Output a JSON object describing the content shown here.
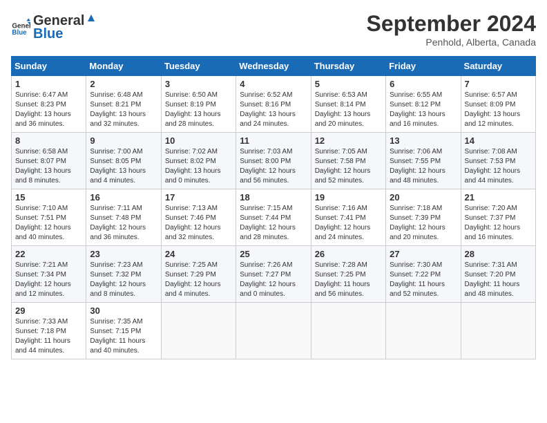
{
  "header": {
    "logo": {
      "general": "General",
      "blue": "Blue"
    },
    "title": "September 2024",
    "location": "Penhold, Alberta, Canada"
  },
  "calendar": {
    "headers": [
      "Sunday",
      "Monday",
      "Tuesday",
      "Wednesday",
      "Thursday",
      "Friday",
      "Saturday"
    ],
    "weeks": [
      [
        {
          "day": "1",
          "info": "Sunrise: 6:47 AM\nSunset: 8:23 PM\nDaylight: 13 hours\nand 36 minutes."
        },
        {
          "day": "2",
          "info": "Sunrise: 6:48 AM\nSunset: 8:21 PM\nDaylight: 13 hours\nand 32 minutes."
        },
        {
          "day": "3",
          "info": "Sunrise: 6:50 AM\nSunset: 8:19 PM\nDaylight: 13 hours\nand 28 minutes."
        },
        {
          "day": "4",
          "info": "Sunrise: 6:52 AM\nSunset: 8:16 PM\nDaylight: 13 hours\nand 24 minutes."
        },
        {
          "day": "5",
          "info": "Sunrise: 6:53 AM\nSunset: 8:14 PM\nDaylight: 13 hours\nand 20 minutes."
        },
        {
          "day": "6",
          "info": "Sunrise: 6:55 AM\nSunset: 8:12 PM\nDaylight: 13 hours\nand 16 minutes."
        },
        {
          "day": "7",
          "info": "Sunrise: 6:57 AM\nSunset: 8:09 PM\nDaylight: 13 hours\nand 12 minutes."
        }
      ],
      [
        {
          "day": "8",
          "info": "Sunrise: 6:58 AM\nSunset: 8:07 PM\nDaylight: 13 hours\nand 8 minutes."
        },
        {
          "day": "9",
          "info": "Sunrise: 7:00 AM\nSunset: 8:05 PM\nDaylight: 13 hours\nand 4 minutes."
        },
        {
          "day": "10",
          "info": "Sunrise: 7:02 AM\nSunset: 8:02 PM\nDaylight: 13 hours\nand 0 minutes."
        },
        {
          "day": "11",
          "info": "Sunrise: 7:03 AM\nSunset: 8:00 PM\nDaylight: 12 hours\nand 56 minutes."
        },
        {
          "day": "12",
          "info": "Sunrise: 7:05 AM\nSunset: 7:58 PM\nDaylight: 12 hours\nand 52 minutes."
        },
        {
          "day": "13",
          "info": "Sunrise: 7:06 AM\nSunset: 7:55 PM\nDaylight: 12 hours\nand 48 minutes."
        },
        {
          "day": "14",
          "info": "Sunrise: 7:08 AM\nSunset: 7:53 PM\nDaylight: 12 hours\nand 44 minutes."
        }
      ],
      [
        {
          "day": "15",
          "info": "Sunrise: 7:10 AM\nSunset: 7:51 PM\nDaylight: 12 hours\nand 40 minutes."
        },
        {
          "day": "16",
          "info": "Sunrise: 7:11 AM\nSunset: 7:48 PM\nDaylight: 12 hours\nand 36 minutes."
        },
        {
          "day": "17",
          "info": "Sunrise: 7:13 AM\nSunset: 7:46 PM\nDaylight: 12 hours\nand 32 minutes."
        },
        {
          "day": "18",
          "info": "Sunrise: 7:15 AM\nSunset: 7:44 PM\nDaylight: 12 hours\nand 28 minutes."
        },
        {
          "day": "19",
          "info": "Sunrise: 7:16 AM\nSunset: 7:41 PM\nDaylight: 12 hours\nand 24 minutes."
        },
        {
          "day": "20",
          "info": "Sunrise: 7:18 AM\nSunset: 7:39 PM\nDaylight: 12 hours\nand 20 minutes."
        },
        {
          "day": "21",
          "info": "Sunrise: 7:20 AM\nSunset: 7:37 PM\nDaylight: 12 hours\nand 16 minutes."
        }
      ],
      [
        {
          "day": "22",
          "info": "Sunrise: 7:21 AM\nSunset: 7:34 PM\nDaylight: 12 hours\nand 12 minutes."
        },
        {
          "day": "23",
          "info": "Sunrise: 7:23 AM\nSunset: 7:32 PM\nDaylight: 12 hours\nand 8 minutes."
        },
        {
          "day": "24",
          "info": "Sunrise: 7:25 AM\nSunset: 7:29 PM\nDaylight: 12 hours\nand 4 minutes."
        },
        {
          "day": "25",
          "info": "Sunrise: 7:26 AM\nSunset: 7:27 PM\nDaylight: 12 hours\nand 0 minutes."
        },
        {
          "day": "26",
          "info": "Sunrise: 7:28 AM\nSunset: 7:25 PM\nDaylight: 11 hours\nand 56 minutes."
        },
        {
          "day": "27",
          "info": "Sunrise: 7:30 AM\nSunset: 7:22 PM\nDaylight: 11 hours\nand 52 minutes."
        },
        {
          "day": "28",
          "info": "Sunrise: 7:31 AM\nSunset: 7:20 PM\nDaylight: 11 hours\nand 48 minutes."
        }
      ],
      [
        {
          "day": "29",
          "info": "Sunrise: 7:33 AM\nSunset: 7:18 PM\nDaylight: 11 hours\nand 44 minutes."
        },
        {
          "day": "30",
          "info": "Sunrise: 7:35 AM\nSunset: 7:15 PM\nDaylight: 11 hours\nand 40 minutes."
        },
        {
          "day": "",
          "info": ""
        },
        {
          "day": "",
          "info": ""
        },
        {
          "day": "",
          "info": ""
        },
        {
          "day": "",
          "info": ""
        },
        {
          "day": "",
          "info": ""
        }
      ]
    ]
  }
}
